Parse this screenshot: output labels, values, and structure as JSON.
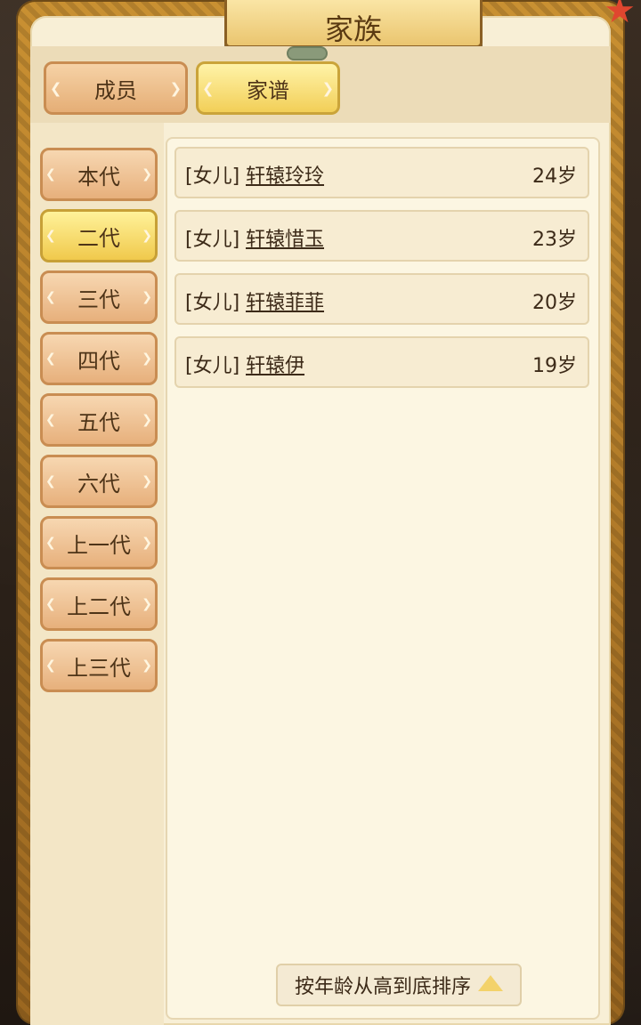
{
  "window": {
    "title": "家族"
  },
  "tabs": [
    {
      "label": "成员",
      "active": false
    },
    {
      "label": "家谱",
      "active": true
    }
  ],
  "generations": [
    {
      "label": "本代",
      "active": false
    },
    {
      "label": "二代",
      "active": true
    },
    {
      "label": "三代",
      "active": false
    },
    {
      "label": "四代",
      "active": false
    },
    {
      "label": "五代",
      "active": false
    },
    {
      "label": "六代",
      "active": false
    },
    {
      "label": "上一代",
      "active": false
    },
    {
      "label": "上二代",
      "active": false
    },
    {
      "label": "上三代",
      "active": false
    }
  ],
  "members": [
    {
      "relation": "[女儿]",
      "name": "轩辕玲玲",
      "age": "24岁"
    },
    {
      "relation": "[女儿]",
      "name": "轩辕惜玉",
      "age": "23岁"
    },
    {
      "relation": "[女儿]",
      "name": "轩辕菲菲",
      "age": "20岁"
    },
    {
      "relation": "[女儿]",
      "name": "轩辕伊",
      "age": "19岁"
    }
  ],
  "sort": {
    "label": "按年龄从高到底排序",
    "icon": "triangle-up-icon"
  },
  "icons": {
    "close": "close-star-icon",
    "drag": "drag-handle-icon"
  },
  "colors": {
    "accent_yellow": "#f0c94c",
    "panel_bg": "#f8efd6",
    "frame": "#c99032"
  }
}
